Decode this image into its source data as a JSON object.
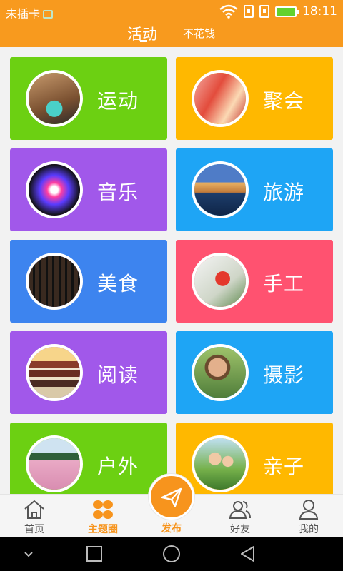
{
  "status_bar": {
    "carrier": "未插卡",
    "time": "18:11"
  },
  "tabs": {
    "active": "活动",
    "other": "不花钱"
  },
  "categories": [
    {
      "label": "运动",
      "color": "#6cd012",
      "icon": "sneakers-photo"
    },
    {
      "label": "聚会",
      "color": "#ffb800",
      "icon": "toast-glasses-photo"
    },
    {
      "label": "音乐",
      "color": "#a158ea",
      "icon": "microphone-photo"
    },
    {
      "label": "旅游",
      "color": "#1ea5f5",
      "icon": "canal-city-photo"
    },
    {
      "label": "美食",
      "color": "#3d84ef",
      "icon": "barbecue-grill-photo"
    },
    {
      "label": "手工",
      "color": "#ff5270",
      "icon": "craft-ornament-photo"
    },
    {
      "label": "阅读",
      "color": "#a158ea",
      "icon": "book-stack-photo"
    },
    {
      "label": "摄影",
      "color": "#1ea5f5",
      "icon": "photographer-photo"
    },
    {
      "label": "户外",
      "color": "#6cd012",
      "icon": "field-tree-photo"
    },
    {
      "label": "亲子",
      "color": "#ffb800",
      "icon": "family-photo"
    }
  ],
  "bottom_nav": {
    "home": "首页",
    "topics": "主题圈",
    "publish": "发布",
    "friends": "好友",
    "me": "我的"
  },
  "colors": {
    "brand": "#f89a1e",
    "accent": "#f7941d"
  }
}
